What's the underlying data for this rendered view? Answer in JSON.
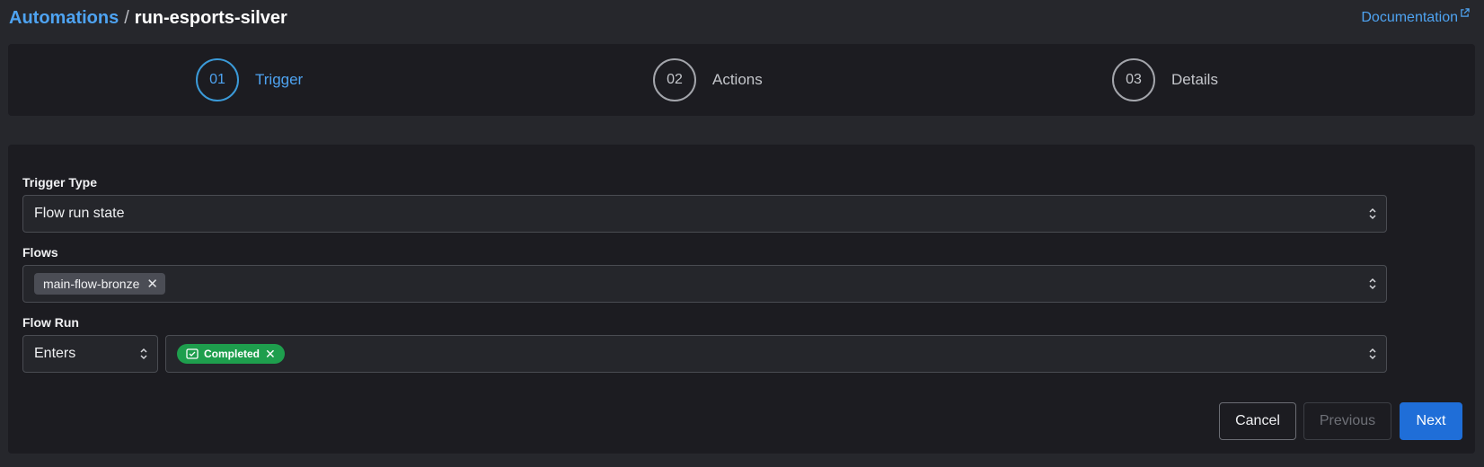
{
  "breadcrumb": {
    "root": "Automations",
    "separator": "/",
    "current": "run-esports-silver"
  },
  "header": {
    "documentation_label": "Documentation"
  },
  "stepper": {
    "steps": [
      {
        "number": "01",
        "label": "Trigger",
        "active": true
      },
      {
        "number": "02",
        "label": "Actions",
        "active": false
      },
      {
        "number": "03",
        "label": "Details",
        "active": false
      }
    ]
  },
  "form": {
    "trigger_type": {
      "label": "Trigger Type",
      "value": "Flow run state"
    },
    "flows": {
      "label": "Flows",
      "selected": [
        "main-flow-bronze"
      ]
    },
    "flow_run": {
      "label": "Flow Run",
      "condition": "Enters",
      "states": [
        "Completed"
      ]
    }
  },
  "buttons": {
    "cancel": "Cancel",
    "previous": "Previous",
    "next": "Next"
  },
  "colors": {
    "accent": "#4ea3f1",
    "primary_button": "#1f6ed8",
    "completed_state": "#1e9e4d",
    "background": "#26272c",
    "panel": "#1c1c21"
  },
  "icons": {
    "documentation": "external-link-icon",
    "select_chevron": "chevron-up-down-icon",
    "tag_remove": "close-icon",
    "completed_state": "completed-check-icon"
  }
}
